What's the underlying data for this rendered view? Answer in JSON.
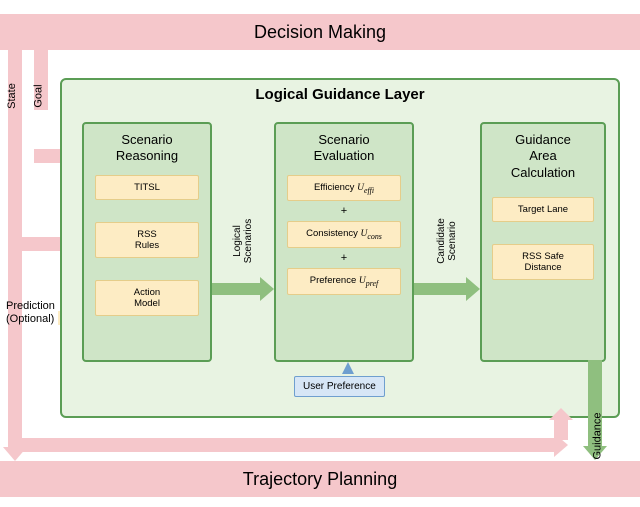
{
  "layers": {
    "top": "Decision Making",
    "bottom": "Trajectory Planning"
  },
  "lgl": {
    "title": "Logical Guidance Layer",
    "modules": {
      "reasoning": {
        "title": "Scenario\nReasoning",
        "items": [
          "TITSL",
          "RSS\nRules",
          "Action\nModel"
        ]
      },
      "evaluation": {
        "title": "Scenario\nEvaluation",
        "items": [
          {
            "label": "Efficiency",
            "sym": "U",
            "sub": "effi"
          },
          {
            "label": "Consistency",
            "sym": "U",
            "sub": "cons"
          },
          {
            "label": "Preference",
            "sym": "U",
            "sub": "pref"
          }
        ],
        "join": "+"
      },
      "calculation": {
        "title": "Guidance\nArea\nCalculation",
        "items": [
          "Target Lane",
          "RSS Safe\nDistance"
        ]
      }
    },
    "arrows": {
      "a1": "Logical Scenarios",
      "a2": "Candidate Scenario"
    },
    "user_pref": "User Preference"
  },
  "inputs": {
    "state": "State",
    "goal": "Goal",
    "prediction": "Prediction\n(Optional)",
    "guidance": "Guidance"
  }
}
